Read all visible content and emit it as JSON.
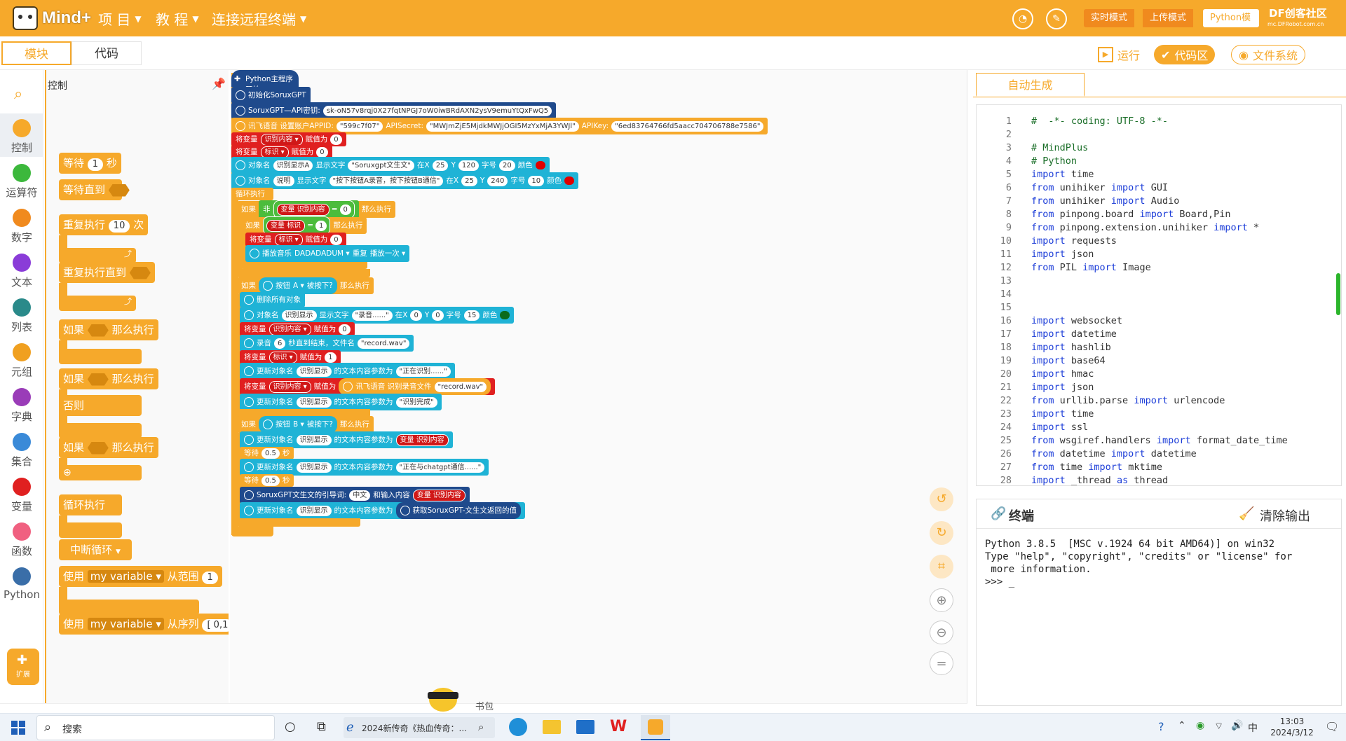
{
  "app": {
    "logo_text": "Mind+",
    "watermark": "DF创客社区",
    "watermark_sub": "mc.DFRobot.com.cn"
  },
  "menu": [
    {
      "label": "项 目"
    },
    {
      "label": "教 程"
    },
    {
      "label": "连接远程终端"
    }
  ],
  "modes": {
    "realtime": "实时模式",
    "upload": "上传模式",
    "python": "Python模式"
  },
  "tabs": {
    "blocks": "模块",
    "code": "代码"
  },
  "actions": {
    "run": "运行",
    "code_area": "代码区",
    "file_system": "文件系统"
  },
  "categories": [
    {
      "label": "控制",
      "color": "#f6a92b"
    },
    {
      "label": "运算符",
      "color": "#3cb83c"
    },
    {
      "label": "数字",
      "color": "#f08a1e"
    },
    {
      "label": "文本",
      "color": "#8a3cd8"
    },
    {
      "label": "列表",
      "color": "#2a8a8a"
    },
    {
      "label": "元组",
      "color": "#f0a020"
    },
    {
      "label": "字典",
      "color": "#9a3cb8"
    },
    {
      "label": "集合",
      "color": "#3a8ad8"
    },
    {
      "label": "变量",
      "color": "#e02020"
    },
    {
      "label": "函数",
      "color": "#f06080"
    },
    {
      "label": "Python",
      "color": "#3a6ea8"
    }
  ],
  "extend_label": "扩展",
  "palette": {
    "title": "控制",
    "wait": "等待",
    "wait_val": "1",
    "seconds": "秒",
    "wait_until": "等待直到",
    "repeat": "重复执行",
    "repeat_val": "10",
    "times": "次",
    "repeat_until": "重复执行直到",
    "if": "如果",
    "then": "那么执行",
    "else": "否则",
    "forever": "循环执行",
    "break": "中断循环",
    "use": "使用",
    "var": "my variable",
    "from_range": "从范围",
    "range_val": "1",
    "from_seq": "从序列",
    "seq_val": "[ 0,1"
  },
  "workspace": {
    "hat": "Python主程序开始",
    "init": "初始化SoruxGPT",
    "api_label": "SoruxGPT—API密钥:",
    "api_key": "sk-oN57v8rqj0X27fqtNPGJ7oW0iwBRdAXN2ysV9emuYtQxFwQ5",
    "xf_label": "讯飞语音 设置账户APPID:",
    "appid": "\"599c7f07\"",
    "apisecret_label": "APISecret:",
    "apisecret": "\"MWJmZjE5MjdkMWJjOGI5MzYxMjA3YWJl\"",
    "apikey_label": "APIKey:",
    "apikey": "\"6ed83764766fd5aacc704706788e7586\"",
    "set_var": "将变量",
    "assign": "赋值为",
    "var_recog": "识别内容",
    "var_flag": "标识",
    "zero": "0",
    "one": "1",
    "obj_label": "对象名",
    "show_text": "显示文字",
    "obj_recog_a": "识别显示A",
    "text1": "\"Soruxgpt文生文\"",
    "at_x": "在X",
    "x25": "25",
    "y": "Y",
    "y120": "120",
    "font": "字号",
    "f20": "20",
    "color": "颜色",
    "obj_desc": "说明",
    "text2": "\"按下按钮A录音，按下按钮B通信\"",
    "y240": "240",
    "f10": "10",
    "forever": "循环执行",
    "if": "如果",
    "not": "非",
    "var_word": "变量",
    "then": "那么执行",
    "play": "播放音乐",
    "music": "DADADADUM",
    "repeat": "重复",
    "play_once": "播放一次",
    "button": "按钮",
    "btn_a": "A",
    "btn_b": "B",
    "pressed": "被按下?",
    "clear_all": "删除所有对象",
    "obj_recog": "识别显示",
    "text_rec": "\"录音......\"",
    "x0": "0",
    "y0": "0",
    "f15": "15",
    "record": "录音",
    "rec_sec": "6",
    "rec_end": "秒直到结束，文件名",
    "rec_file": "\"record.wav\"",
    "update": "更新对象名",
    "update_param": "的文本内容参数为",
    "text_recognizing": "\"正在识别......\"",
    "xf_recog": "讯飞语音 识别录音文件",
    "text_done": "\"识别完成\"",
    "wait": "等待",
    "half": "0.5",
    "sec": "秒",
    "text_comm": "\"正在与chatgpt通信......\"",
    "gpt_prompt": "SoruxGPT文生文的引导词:",
    "zh": "中文",
    "and_input": "和输入内容",
    "gpt_result": "获取SoruxGPT-文生文返回的值"
  },
  "code_tab": "自动生成",
  "code_lines": [
    {
      "n": "1",
      "t": "#  -*- coding: UTF-8 -*-",
      "c": true
    },
    {
      "n": "2",
      "t": ""
    },
    {
      "n": "3",
      "t": "# MindPlus",
      "c": true
    },
    {
      "n": "4",
      "t": "# Python",
      "c": true
    },
    {
      "n": "5",
      "k": "import",
      "t": " time"
    },
    {
      "n": "6",
      "k": "from",
      "t": " unihiker ",
      "k2": "import",
      "t2": " GUI"
    },
    {
      "n": "7",
      "k": "from",
      "t": " unihiker ",
      "k2": "import",
      "t2": " Audio"
    },
    {
      "n": "8",
      "k": "from",
      "t": " pinpong.board ",
      "k2": "import",
      "t2": " Board,Pin"
    },
    {
      "n": "9",
      "k": "from",
      "t": " pinpong.extension.unihiker ",
      "k2": "import",
      "t2": " *"
    },
    {
      "n": "10",
      "k": "import",
      "t": " requests"
    },
    {
      "n": "11",
      "k": "import",
      "t": " json"
    },
    {
      "n": "12",
      "k": "from",
      "t": " PIL ",
      "k2": "import",
      "t2": " Image"
    },
    {
      "n": "13",
      "t": ""
    },
    {
      "n": "14",
      "t": ""
    },
    {
      "n": "15",
      "t": ""
    },
    {
      "n": "16",
      "k": "import",
      "t": " websocket"
    },
    {
      "n": "17",
      "k": "import",
      "t": " datetime"
    },
    {
      "n": "18",
      "k": "import",
      "t": " hashlib"
    },
    {
      "n": "19",
      "k": "import",
      "t": " base64"
    },
    {
      "n": "20",
      "k": "import",
      "t": " hmac"
    },
    {
      "n": "21",
      "k": "import",
      "t": " json"
    },
    {
      "n": "22",
      "k": "from",
      "t": " urllib.parse ",
      "k2": "import",
      "t2": " urlencode"
    },
    {
      "n": "23",
      "k": "import",
      "t": " time"
    },
    {
      "n": "24",
      "k": "import",
      "t": " ssl"
    },
    {
      "n": "25",
      "k": "from",
      "t": " wsgiref.handlers ",
      "k2": "import",
      "t2": " format_date_time"
    },
    {
      "n": "26",
      "k": "from",
      "t": " datetime ",
      "k2": "import",
      "t2": " datetime"
    },
    {
      "n": "27",
      "k": "from",
      "t": " time ",
      "k2": "import",
      "t2": " mktime"
    },
    {
      "n": "28",
      "k": "import",
      "t": " _thread ",
      "k2": "as",
      "t2": " thread"
    }
  ],
  "terminal": {
    "title": "终端",
    "clear": "清除输出",
    "output": "Python 3.8.5  [MSC v.1924 64 bit AMD64)] on win32\nType \"help\", \"copyright\", \"credits\" or \"license\" for\n more information.\n>>> _"
  },
  "bottom": {
    "book_label": "书包"
  },
  "taskbar": {
    "search": "搜索",
    "app_title": "2024新传奇《热血传奇：...",
    "ime": "中",
    "time": "13:03",
    "date": "2024/3/12"
  }
}
